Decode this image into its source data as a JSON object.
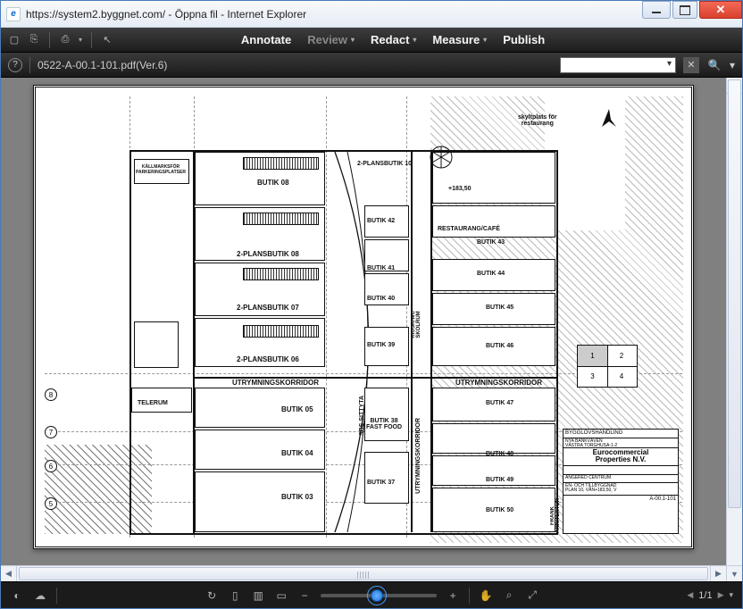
{
  "window": {
    "title": "https://system2.byggnet.com/ - Öppna fil - Internet Explorer"
  },
  "menu": {
    "annotate": "Annotate",
    "review": "Review",
    "redact": "Redact",
    "measure": "Measure",
    "publish": "Publish"
  },
  "subbar": {
    "filename": "0522-A-00.1-101.pdf(Ver.6)"
  },
  "plan": {
    "skylt": "skyltplats för\nrestaurang",
    "level": "+183,50",
    "butik08": "BUTIK 08",
    "tvaplan10": "2-PLANSBUTIK 10",
    "tvaplan08": "2-PLANSBUTIK 08",
    "tvaplan07": "2-PLANSBUTIK 07",
    "tvaplan06": "2-PLANSBUTIK 06",
    "utrym": "UTRYMNINGSKORRIDOR",
    "utrym2": "UTRYMNINGSKORRIDOR",
    "butik05": "BUTIK 05",
    "butik04": "BUTIK 04",
    "butik03": "BUTIK 03",
    "butik42": "BUTIK 42",
    "butik41": "BUTIK 41",
    "butik40": "BUTIK 40",
    "butik39": "BUTIK 39",
    "butik38": "BUTIK 38\nFAST FOOD",
    "butik37": "BUTIK 37",
    "butik43": "BUTIK 43",
    "butik44": "BUTIK 44",
    "butik45": "BUTIK 45",
    "butik46": "BUTIK 46",
    "butik47": "BUTIK 47",
    "butik48": "BUTIK 48",
    "butik49": "BUTIK 49",
    "butik50": "BUTIK 50",
    "restaurangcafe": "RESTAURANG/CAFÉ",
    "telerum": "TELERUM",
    "sbsityta": "SBS SITTYTA",
    "utrymv": "UTRYMNINGSKORRIDOR",
    "kallmark": "KÄLLMARKSFÖR\nPARKERINGSPLATSER",
    "kiosk": "KIOSK/WC\nSKOLRUM",
    "handling": "BYGGLOVSHANDLING",
    "company": "Eurocommercial\nProperties N.V.",
    "projekt": "ANGERED CENTRUM",
    "ritn": "EN- OCH TILLBYGGNAD\nPLAN 10, VÅN+183,50, V",
    "scale": "A-00.1-101",
    "frank": "FRANK\nARKITEKTUR"
  },
  "status": {
    "page": "1/1"
  }
}
